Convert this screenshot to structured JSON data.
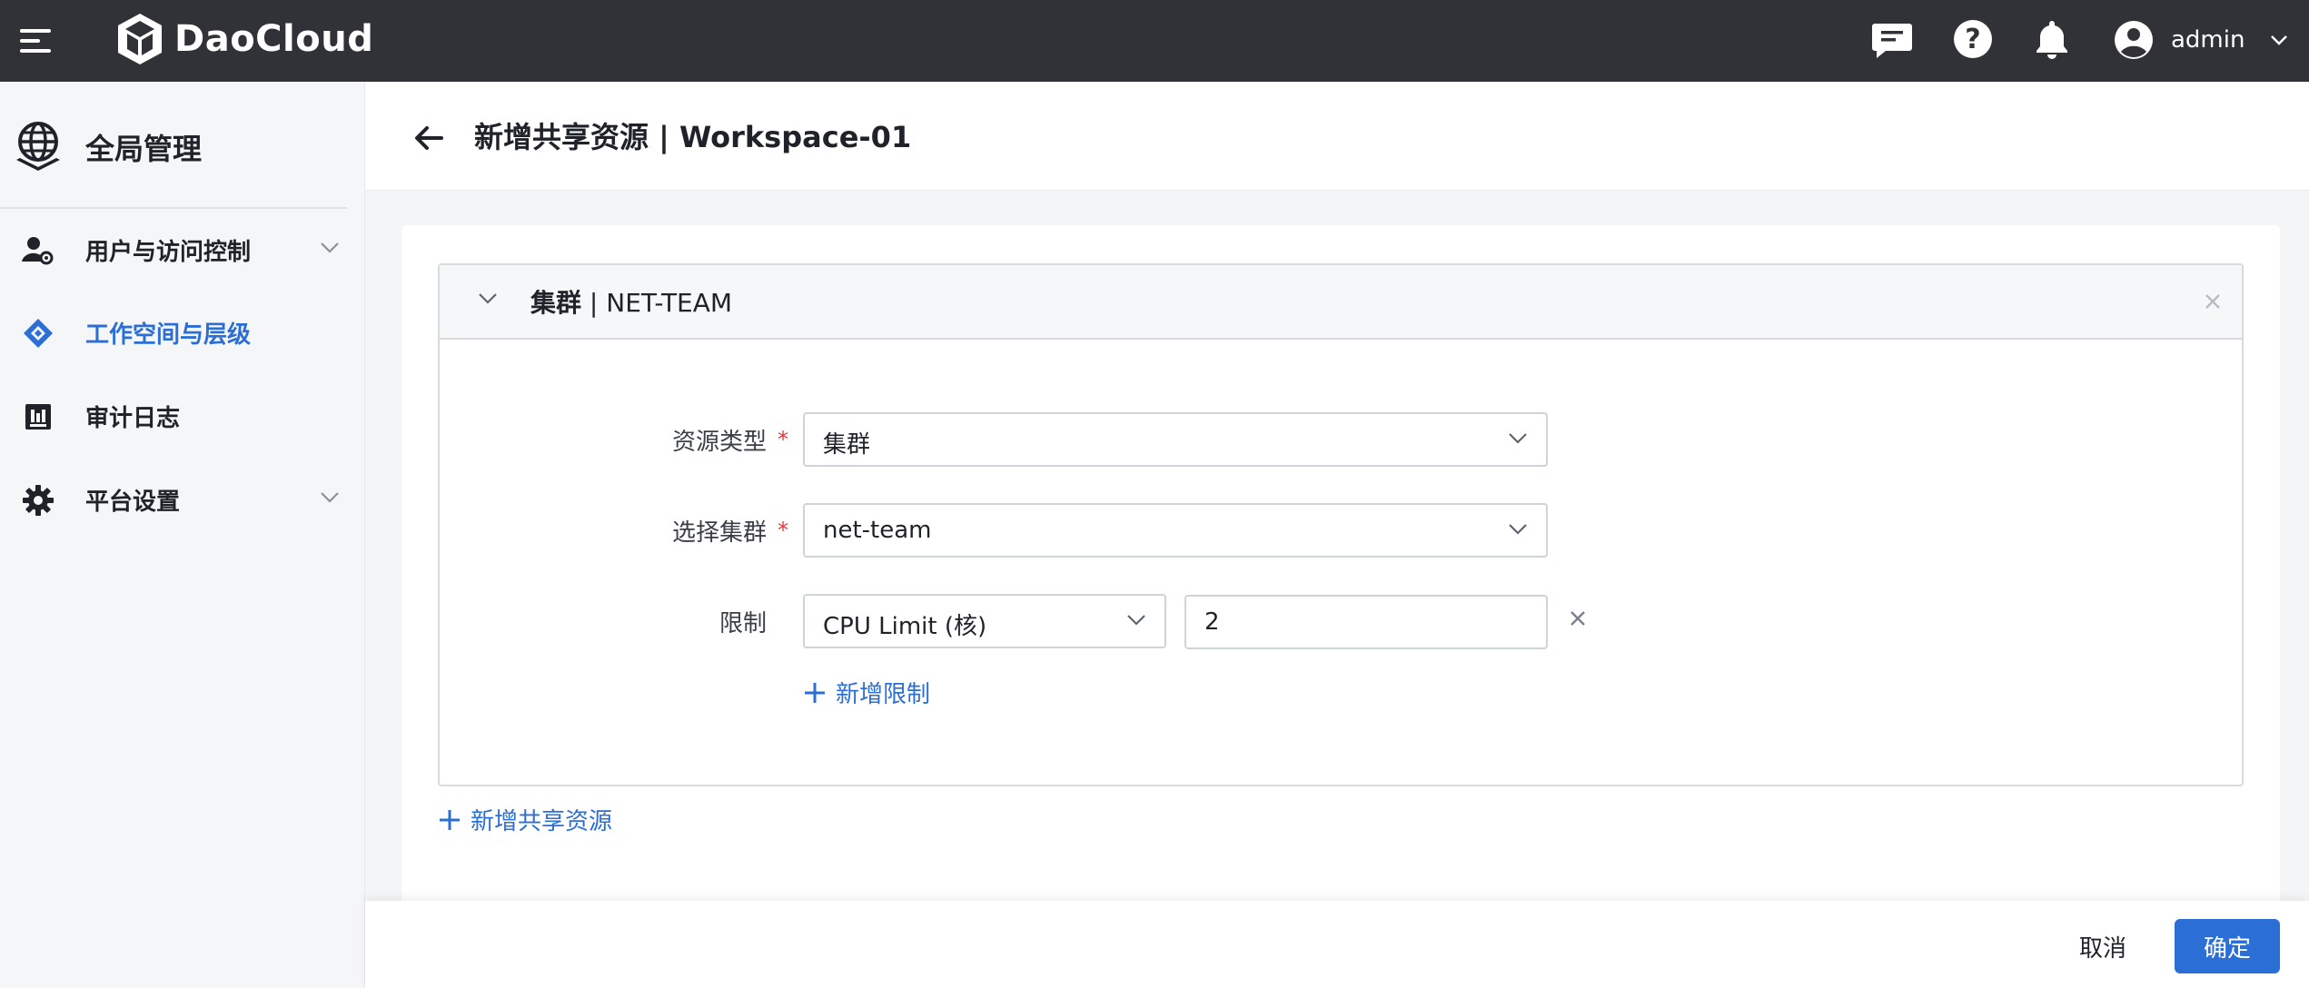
{
  "topbar": {
    "brand": "DaoCloud",
    "user_name": "admin",
    "icons": [
      "menu-icon",
      "message-icon",
      "help-icon",
      "bell-icon",
      "user-avatar-icon",
      "chevron-down-icon"
    ]
  },
  "sidebar": {
    "title": "全局管理",
    "items": [
      {
        "label": "用户与访问控制",
        "icon": "user-settings-icon",
        "expandable": true,
        "active": false
      },
      {
        "label": "工作空间与层级",
        "icon": "workspace-icon",
        "expandable": false,
        "active": true
      },
      {
        "label": "审计日志",
        "icon": "audit-log-icon",
        "expandable": false,
        "active": false
      },
      {
        "label": "平台设置",
        "icon": "gear-icon",
        "expandable": true,
        "active": false
      }
    ]
  },
  "page": {
    "title": "新增共享资源 | Workspace-01"
  },
  "panel": {
    "title_prefix": "集群",
    "title_suffix": " | NET-TEAM",
    "fields": {
      "resource_type_label": "资源类型",
      "resource_type_value": "集群",
      "cluster_label": "选择集群",
      "cluster_value": "net-team",
      "limit_label": "限制",
      "limit_type_value": "CPU Limit (核)",
      "limit_amount_value": "2"
    },
    "add_limit_label": "新增限制"
  },
  "add_shared_resource_label": "新增共享资源",
  "footer": {
    "cancel_label": "取消",
    "confirm_label": "确定"
  },
  "colors": {
    "topbar": "#303238",
    "accent": "#2b6fd6",
    "required": "#e03b3b"
  }
}
